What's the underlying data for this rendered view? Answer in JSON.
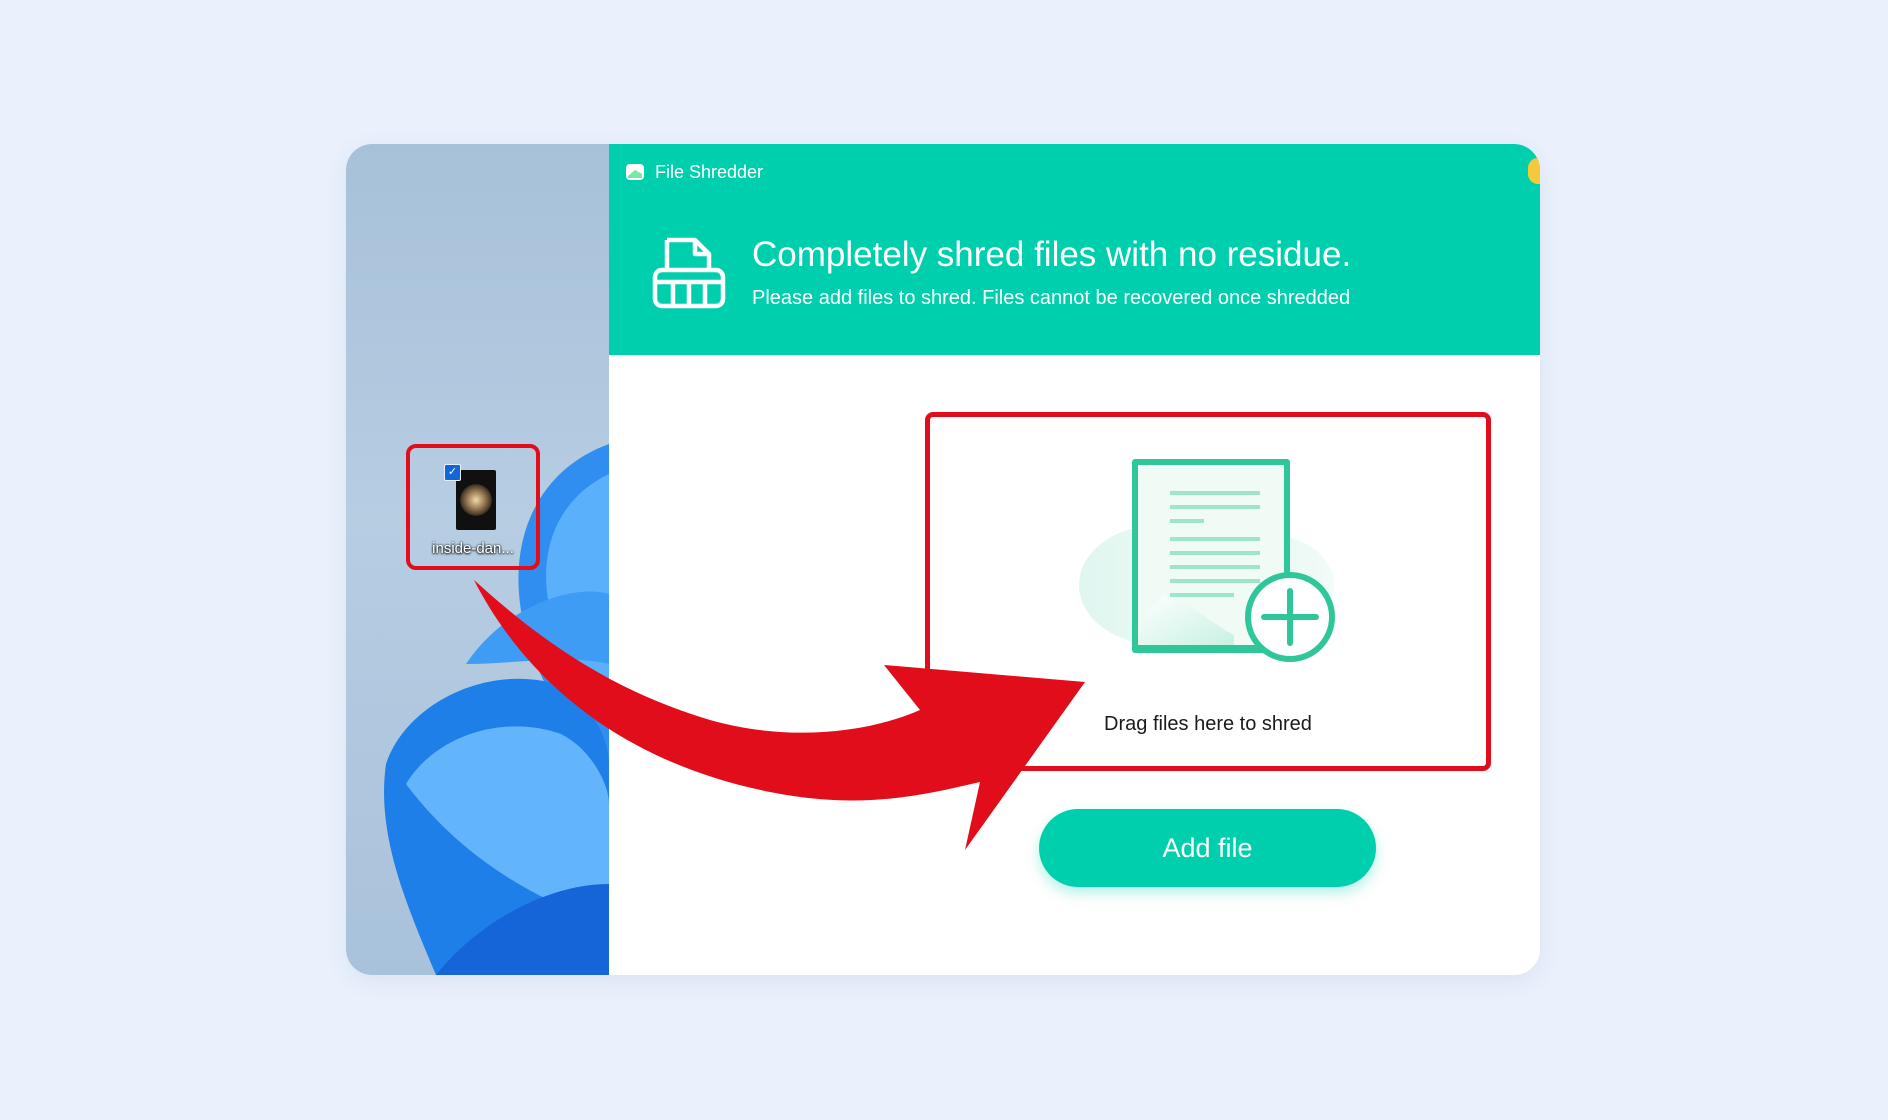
{
  "app": {
    "title": "File Shredder",
    "headline": "Completely shred files with no residue.",
    "subline": "Please add files to shred. Files cannot be recovered once shredded"
  },
  "desktop": {
    "file_name": "inside-dan...",
    "file_selected": true
  },
  "dropzone": {
    "label": "Drag files here to shred"
  },
  "actions": {
    "add_file_label": "Add file"
  },
  "icons": {
    "app_logo": "app-logo-icon",
    "shredder": "shredder-icon",
    "add_document": "add-document-icon",
    "file_thumbnail": "image-file-icon",
    "checkbox": "checkbox-icon",
    "arrow": "drag-arrow-icon"
  },
  "colors": {
    "accent": "#00cfae",
    "highlight": "#e20d1a",
    "background": "#eaf1fd"
  }
}
